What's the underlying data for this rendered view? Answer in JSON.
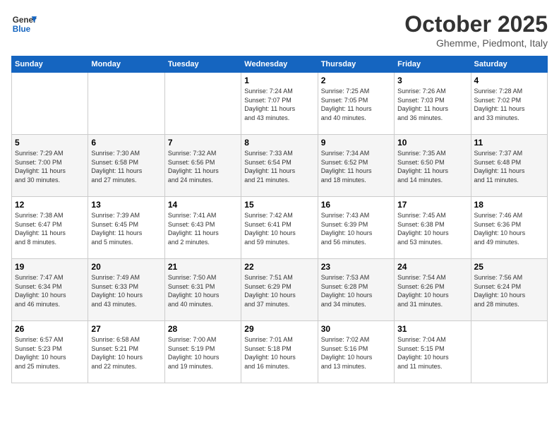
{
  "header": {
    "logo_line1": "General",
    "logo_line2": "Blue",
    "month": "October 2025",
    "location": "Ghemme, Piedmont, Italy"
  },
  "days_of_week": [
    "Sunday",
    "Monday",
    "Tuesday",
    "Wednesday",
    "Thursday",
    "Friday",
    "Saturday"
  ],
  "weeks": [
    [
      {
        "day": "",
        "info": ""
      },
      {
        "day": "",
        "info": ""
      },
      {
        "day": "",
        "info": ""
      },
      {
        "day": "1",
        "info": "Sunrise: 7:24 AM\nSunset: 7:07 PM\nDaylight: 11 hours\nand 43 minutes."
      },
      {
        "day": "2",
        "info": "Sunrise: 7:25 AM\nSunset: 7:05 PM\nDaylight: 11 hours\nand 40 minutes."
      },
      {
        "day": "3",
        "info": "Sunrise: 7:26 AM\nSunset: 7:03 PM\nDaylight: 11 hours\nand 36 minutes."
      },
      {
        "day": "4",
        "info": "Sunrise: 7:28 AM\nSunset: 7:02 PM\nDaylight: 11 hours\nand 33 minutes."
      }
    ],
    [
      {
        "day": "5",
        "info": "Sunrise: 7:29 AM\nSunset: 7:00 PM\nDaylight: 11 hours\nand 30 minutes."
      },
      {
        "day": "6",
        "info": "Sunrise: 7:30 AM\nSunset: 6:58 PM\nDaylight: 11 hours\nand 27 minutes."
      },
      {
        "day": "7",
        "info": "Sunrise: 7:32 AM\nSunset: 6:56 PM\nDaylight: 11 hours\nand 24 minutes."
      },
      {
        "day": "8",
        "info": "Sunrise: 7:33 AM\nSunset: 6:54 PM\nDaylight: 11 hours\nand 21 minutes."
      },
      {
        "day": "9",
        "info": "Sunrise: 7:34 AM\nSunset: 6:52 PM\nDaylight: 11 hours\nand 18 minutes."
      },
      {
        "day": "10",
        "info": "Sunrise: 7:35 AM\nSunset: 6:50 PM\nDaylight: 11 hours\nand 14 minutes."
      },
      {
        "day": "11",
        "info": "Sunrise: 7:37 AM\nSunset: 6:48 PM\nDaylight: 11 hours\nand 11 minutes."
      }
    ],
    [
      {
        "day": "12",
        "info": "Sunrise: 7:38 AM\nSunset: 6:47 PM\nDaylight: 11 hours\nand 8 minutes."
      },
      {
        "day": "13",
        "info": "Sunrise: 7:39 AM\nSunset: 6:45 PM\nDaylight: 11 hours\nand 5 minutes."
      },
      {
        "day": "14",
        "info": "Sunrise: 7:41 AM\nSunset: 6:43 PM\nDaylight: 11 hours\nand 2 minutes."
      },
      {
        "day": "15",
        "info": "Sunrise: 7:42 AM\nSunset: 6:41 PM\nDaylight: 10 hours\nand 59 minutes."
      },
      {
        "day": "16",
        "info": "Sunrise: 7:43 AM\nSunset: 6:39 PM\nDaylight: 10 hours\nand 56 minutes."
      },
      {
        "day": "17",
        "info": "Sunrise: 7:45 AM\nSunset: 6:38 PM\nDaylight: 10 hours\nand 53 minutes."
      },
      {
        "day": "18",
        "info": "Sunrise: 7:46 AM\nSunset: 6:36 PM\nDaylight: 10 hours\nand 49 minutes."
      }
    ],
    [
      {
        "day": "19",
        "info": "Sunrise: 7:47 AM\nSunset: 6:34 PM\nDaylight: 10 hours\nand 46 minutes."
      },
      {
        "day": "20",
        "info": "Sunrise: 7:49 AM\nSunset: 6:33 PM\nDaylight: 10 hours\nand 43 minutes."
      },
      {
        "day": "21",
        "info": "Sunrise: 7:50 AM\nSunset: 6:31 PM\nDaylight: 10 hours\nand 40 minutes."
      },
      {
        "day": "22",
        "info": "Sunrise: 7:51 AM\nSunset: 6:29 PM\nDaylight: 10 hours\nand 37 minutes."
      },
      {
        "day": "23",
        "info": "Sunrise: 7:53 AM\nSunset: 6:28 PM\nDaylight: 10 hours\nand 34 minutes."
      },
      {
        "day": "24",
        "info": "Sunrise: 7:54 AM\nSunset: 6:26 PM\nDaylight: 10 hours\nand 31 minutes."
      },
      {
        "day": "25",
        "info": "Sunrise: 7:56 AM\nSunset: 6:24 PM\nDaylight: 10 hours\nand 28 minutes."
      }
    ],
    [
      {
        "day": "26",
        "info": "Sunrise: 6:57 AM\nSunset: 5:23 PM\nDaylight: 10 hours\nand 25 minutes."
      },
      {
        "day": "27",
        "info": "Sunrise: 6:58 AM\nSunset: 5:21 PM\nDaylight: 10 hours\nand 22 minutes."
      },
      {
        "day": "28",
        "info": "Sunrise: 7:00 AM\nSunset: 5:19 PM\nDaylight: 10 hours\nand 19 minutes."
      },
      {
        "day": "29",
        "info": "Sunrise: 7:01 AM\nSunset: 5:18 PM\nDaylight: 10 hours\nand 16 minutes."
      },
      {
        "day": "30",
        "info": "Sunrise: 7:02 AM\nSunset: 5:16 PM\nDaylight: 10 hours\nand 13 minutes."
      },
      {
        "day": "31",
        "info": "Sunrise: 7:04 AM\nSunset: 5:15 PM\nDaylight: 10 hours\nand 11 minutes."
      },
      {
        "day": "",
        "info": ""
      }
    ]
  ]
}
